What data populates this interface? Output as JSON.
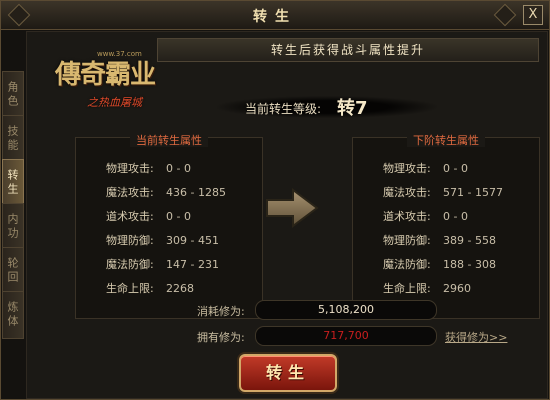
{
  "window": {
    "title": "转生",
    "close_label": "X"
  },
  "tabs": [
    {
      "label": "角色",
      "active": false
    },
    {
      "label": "技能",
      "active": false
    },
    {
      "label": "转生",
      "active": true
    },
    {
      "label": "内功",
      "active": false
    },
    {
      "label": "轮回",
      "active": false
    },
    {
      "label": "炼体",
      "active": false
    }
  ],
  "header": {
    "text": "转生后获得战斗属性提升"
  },
  "logo": {
    "name": "傳奇霸业",
    "subtitle": "之热血屠城",
    "url": "www.37.com"
  },
  "level": {
    "label": "当前转生等级:",
    "value": "转7"
  },
  "current": {
    "title": "当前转生属性",
    "stats": [
      {
        "name": "物理攻击:",
        "value": "0 - 0"
      },
      {
        "name": "魔法攻击:",
        "value": "436 - 1285"
      },
      {
        "name": "道术攻击:",
        "value": "0 - 0"
      },
      {
        "name": "物理防御:",
        "value": "309 - 451"
      },
      {
        "name": "魔法防御:",
        "value": "147 - 231"
      },
      {
        "name": "生命上限:",
        "value": "2268"
      }
    ]
  },
  "next": {
    "title": "下阶转生属性",
    "stats": [
      {
        "name": "物理攻击:",
        "value": "0 - 0"
      },
      {
        "name": "魔法攻击:",
        "value": "571 - 1577"
      },
      {
        "name": "道术攻击:",
        "value": "0 - 0"
      },
      {
        "name": "物理防御:",
        "value": "389 - 558"
      },
      {
        "name": "魔法防御:",
        "value": "188 - 308"
      },
      {
        "name": "生命上限:",
        "value": "2960"
      }
    ]
  },
  "cost": {
    "consume_label": "消耗修为:",
    "consume_value": "5,108,200",
    "have_label": "拥有修为:",
    "have_value": "717,700",
    "get_link": "获得修为>>"
  },
  "action": {
    "button_label": "转生"
  },
  "colors": {
    "accent_gold": "#d2a868",
    "insufficient_red": "#c81e1e",
    "title_orange": "#e06a40",
    "button_red": "#c23a28"
  },
  "icons": {
    "arrow": "right-arrow-icon"
  }
}
